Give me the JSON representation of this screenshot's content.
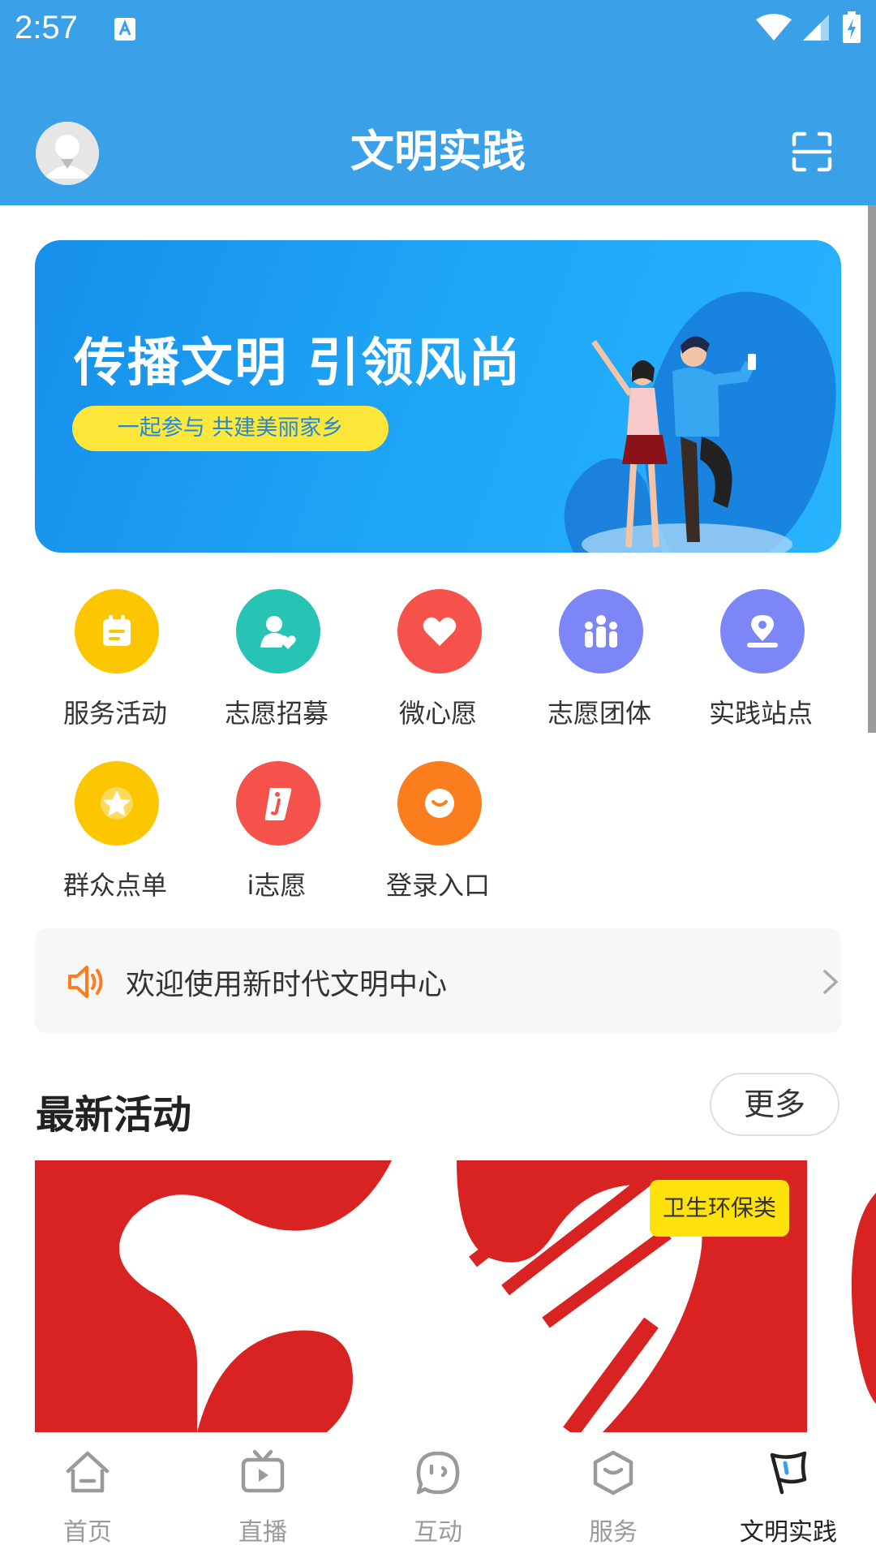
{
  "status_bar": {
    "time": "2:57"
  },
  "header": {
    "title": "文明实践"
  },
  "banner": {
    "headline": "传播文明 引领风尚",
    "tagline": "一起参与 共建美丽家乡"
  },
  "menu": [
    {
      "label": "服务活动",
      "icon": "calendar-icon",
      "color": "#fcc600"
    },
    {
      "label": "志愿招募",
      "icon": "person-heart-icon",
      "color": "#27c4b5"
    },
    {
      "label": "微心愿",
      "icon": "heart-icon",
      "color": "#f5524c"
    },
    {
      "label": "志愿团体",
      "icon": "group-icon",
      "color": "#7d86f6"
    },
    {
      "label": "实践站点",
      "icon": "location-icon",
      "color": "#7d86f6"
    },
    {
      "label": "群众点单",
      "icon": "star-icon",
      "color": "#fcc600"
    },
    {
      "label": "i志愿",
      "icon": "i-volunteer-icon",
      "color": "#f5524c"
    },
    {
      "label": "登录入口",
      "icon": "login-icon",
      "color": "#fb7d1e"
    }
  ],
  "notice": {
    "text": "欢迎使用新时代文明中心"
  },
  "latest": {
    "title": "最新活动",
    "more_label": "更多",
    "cards": [
      {
        "tag": "卫生环保类"
      }
    ]
  },
  "bottom_nav": [
    {
      "label": "首页",
      "icon": "home-icon",
      "active": false
    },
    {
      "label": "直播",
      "icon": "tv-icon",
      "active": false
    },
    {
      "label": "互动",
      "icon": "chat-icon",
      "active": false
    },
    {
      "label": "服务",
      "icon": "service-icon",
      "active": false
    },
    {
      "label": "文明实践",
      "icon": "flag-icon",
      "active": true
    }
  ],
  "colors": {
    "header_bg": "#3aa1e9",
    "tag_bg": "#ffe10b",
    "nav_active": "#222222",
    "nav_inactive": "#9a9a9a"
  }
}
